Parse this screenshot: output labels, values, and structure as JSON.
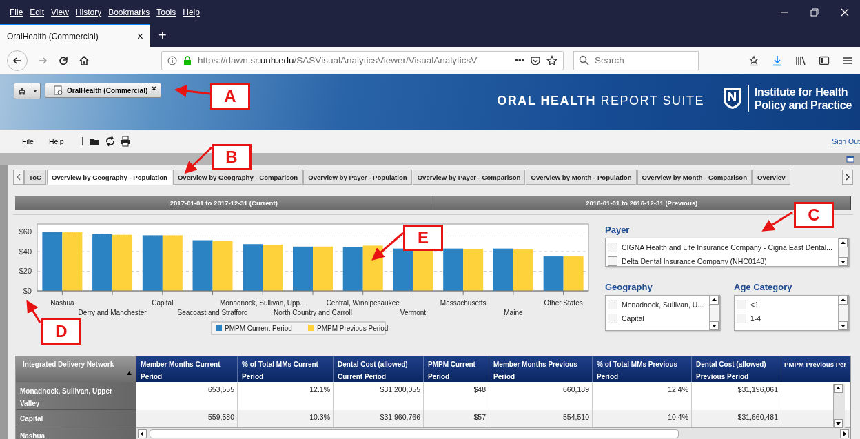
{
  "browser": {
    "menu": [
      "File",
      "Edit",
      "View",
      "History",
      "Bookmarks",
      "Tools",
      "Help"
    ],
    "tab": {
      "title": "OralHealth (Commercial)",
      "close": "×"
    },
    "new_tab": "+",
    "url": "https://dawn.sr.**unh.edu**/SASVisualAnalyticsViewer/VisualAnalyticsV",
    "page_actions": "•••",
    "search": {
      "placeholder": "Search"
    }
  },
  "banner": {
    "report_tab": {
      "title": "OralHealth (Commercial)",
      "close": "×"
    },
    "suite_title": "**ORAL HEALTH** REPORT SUITE",
    "org": [
      "Institute for Health",
      "Policy and Practice"
    ]
  },
  "toolbar": {
    "menu": [
      "File",
      "Help"
    ],
    "sign_out": "Sign Out"
  },
  "report_tabs": [
    {
      "label": "ToC",
      "selected": false
    },
    {
      "label": "Overview by Geography - Population",
      "selected": true
    },
    {
      "label": "Overview by Geography - Comparison",
      "selected": false
    },
    {
      "label": "Overview by Payer - Population",
      "selected": false
    },
    {
      "label": "Overview by Payer - Comparison",
      "selected": false
    },
    {
      "label": "Overview by Month - Population",
      "selected": false
    },
    {
      "label": "Overview by Month - Comparison",
      "selected": false
    },
    {
      "label": "Overviev",
      "selected": false
    }
  ],
  "periods": [
    "2017-01-01 to 2017-12-31 (Current)",
    "2016-01-01 to 2016-12-31 (Previous)"
  ],
  "chart": {
    "chart_data": {
      "type": "bar",
      "categories": [
        "Nashua",
        "Derry and Manchester",
        "Capital",
        "Seacoast and Strafford",
        "Monadnock, Sullivan, Upp...",
        "North Country and Carroll",
        "Central, Winnipesaukee",
        "Vermont",
        "Massachusetts",
        "Maine",
        "Other States"
      ],
      "series": [
        {
          "name": "PMPM Current Period",
          "color": "#2b83c4",
          "values": [
            60,
            57.5,
            56.5,
            51.5,
            47.5,
            45,
            44.5,
            43,
            43,
            43,
            35
          ]
        },
        {
          "name": "PMPM Previous Period",
          "color": "#fdd23a",
          "values": [
            59.5,
            57,
            56.5,
            50.5,
            47,
            45,
            46,
            42,
            42.5,
            42,
            35
          ]
        }
      ],
      "ylim": [
        0,
        68
      ],
      "grid": true,
      "legend": true,
      "yticks": [
        {
          "value": 0,
          "label": "$0"
        },
        {
          "value": 20,
          "label": "$20"
        },
        {
          "value": 40,
          "label": "$40"
        },
        {
          "value": 60,
          "label": "$60"
        }
      ]
    }
  },
  "filters": [
    {
      "title": "Payer",
      "items": [
        {
          "label": "CIGNA Health and Life Insurance Company - Cigna East Dental...",
          "checked": false
        },
        {
          "label": "Delta Dental Insurance Company (NHC0148)",
          "checked": false
        }
      ]
    },
    {
      "title": "Geography",
      "items": [
        {
          "label": "Monadnock, Sullivan, U...",
          "checked": false
        },
        {
          "label": "Capital",
          "checked": false
        }
      ]
    },
    {
      "title": "Age Category",
      "items": [
        {
          "label": "<1",
          "checked": false
        },
        {
          "label": "1-4",
          "checked": false
        }
      ]
    }
  ],
  "table": {
    "columns": [
      {
        "title": "Integrated Delivery Network",
        "sort_ascending": true
      },
      {
        "title": "Member Months Current Period"
      },
      {
        "title": "% of Total MMs Current Period"
      },
      {
        "title": "Dental Cost (allowed) Current Period"
      },
      {
        "title": "PMPM Current Period"
      },
      {
        "title": "Member Months Previous Period"
      },
      {
        "title": "% of Total MMs Previous Period"
      },
      {
        "title": "Dental Cost (allowed) Previous Period"
      },
      {
        "title": "PMPM Previous Per"
      }
    ],
    "rows": [
      {
        "label": "Monadnock, Sullivan, Upper Valley",
        "cells": [
          "653,555",
          "12.1%",
          "$31,200,055",
          "$48",
          "660,189",
          "12.4%",
          "$31,196,061"
        ]
      },
      {
        "label": "Capital",
        "cells": [
          "559,580",
          "10.3%",
          "$31,960,766",
          "$57",
          "554,510",
          "10.4%",
          "$31,660,481"
        ]
      },
      {
        "label": "Nashua"
      }
    ]
  },
  "annotations": [
    {
      "label": "A"
    },
    {
      "label": "B"
    },
    {
      "label": "C"
    },
    {
      "label": "D"
    },
    {
      "label": "E"
    }
  ]
}
